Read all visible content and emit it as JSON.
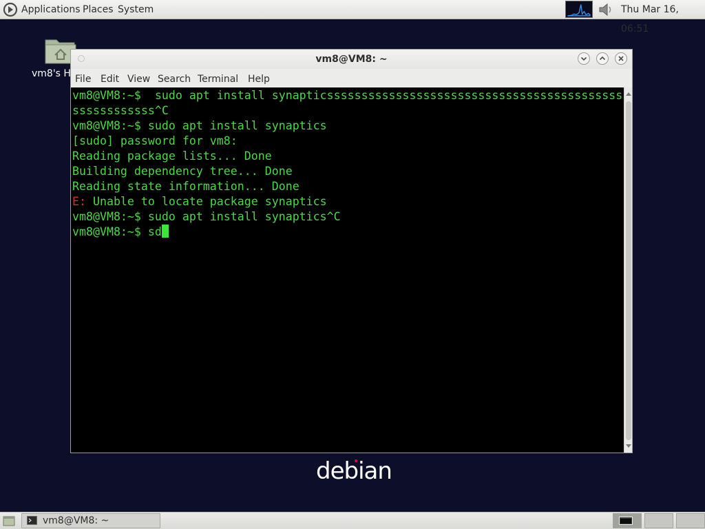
{
  "top_panel": {
    "menus": [
      "Applications",
      "Places",
      "System"
    ],
    "clock": "Thu Mar 16, 06:51",
    "icons": [
      "debian-foot-logo-icon",
      "cpu-monitor-graph",
      "volume-icon"
    ]
  },
  "desktop": {
    "home_icon_label": "vm8's H",
    "home_icon": "home-folder-icon",
    "wallpaper_logo": "debian"
  },
  "terminal": {
    "title": "vm8@VM8: ~",
    "menus": [
      "File",
      "Edit",
      "View",
      "Search",
      "Terminal",
      "Help"
    ],
    "lines": [
      "vm8@VM8:~$  sudo apt install synapticsssssssssssssssssssssssssssssssssssssssssssssssss",
      "ssssssssssss^C",
      "vm8@VM8:~$ sudo apt install synaptics",
      "[sudo] password for vm8:",
      "Reading package lists... Done",
      "Building dependency tree... Done",
      "Reading state information... Done",
      {
        "prefix": "E:",
        "text": " Unable to locate package synaptics"
      },
      "vm8@VM8:~$ sudo apt install synaptics^C",
      {
        "prompt": "vm8@VM8:~$ sd",
        "cursor": true
      }
    ],
    "colors": {
      "text": "#4fd64a",
      "error": "#e02b2b",
      "background": "#000000"
    }
  },
  "bottom_panel": {
    "task_label": "vm8@VM8: ~",
    "task_icon": "terminal-icon",
    "workspaces": 3,
    "active_workspace": 1
  }
}
